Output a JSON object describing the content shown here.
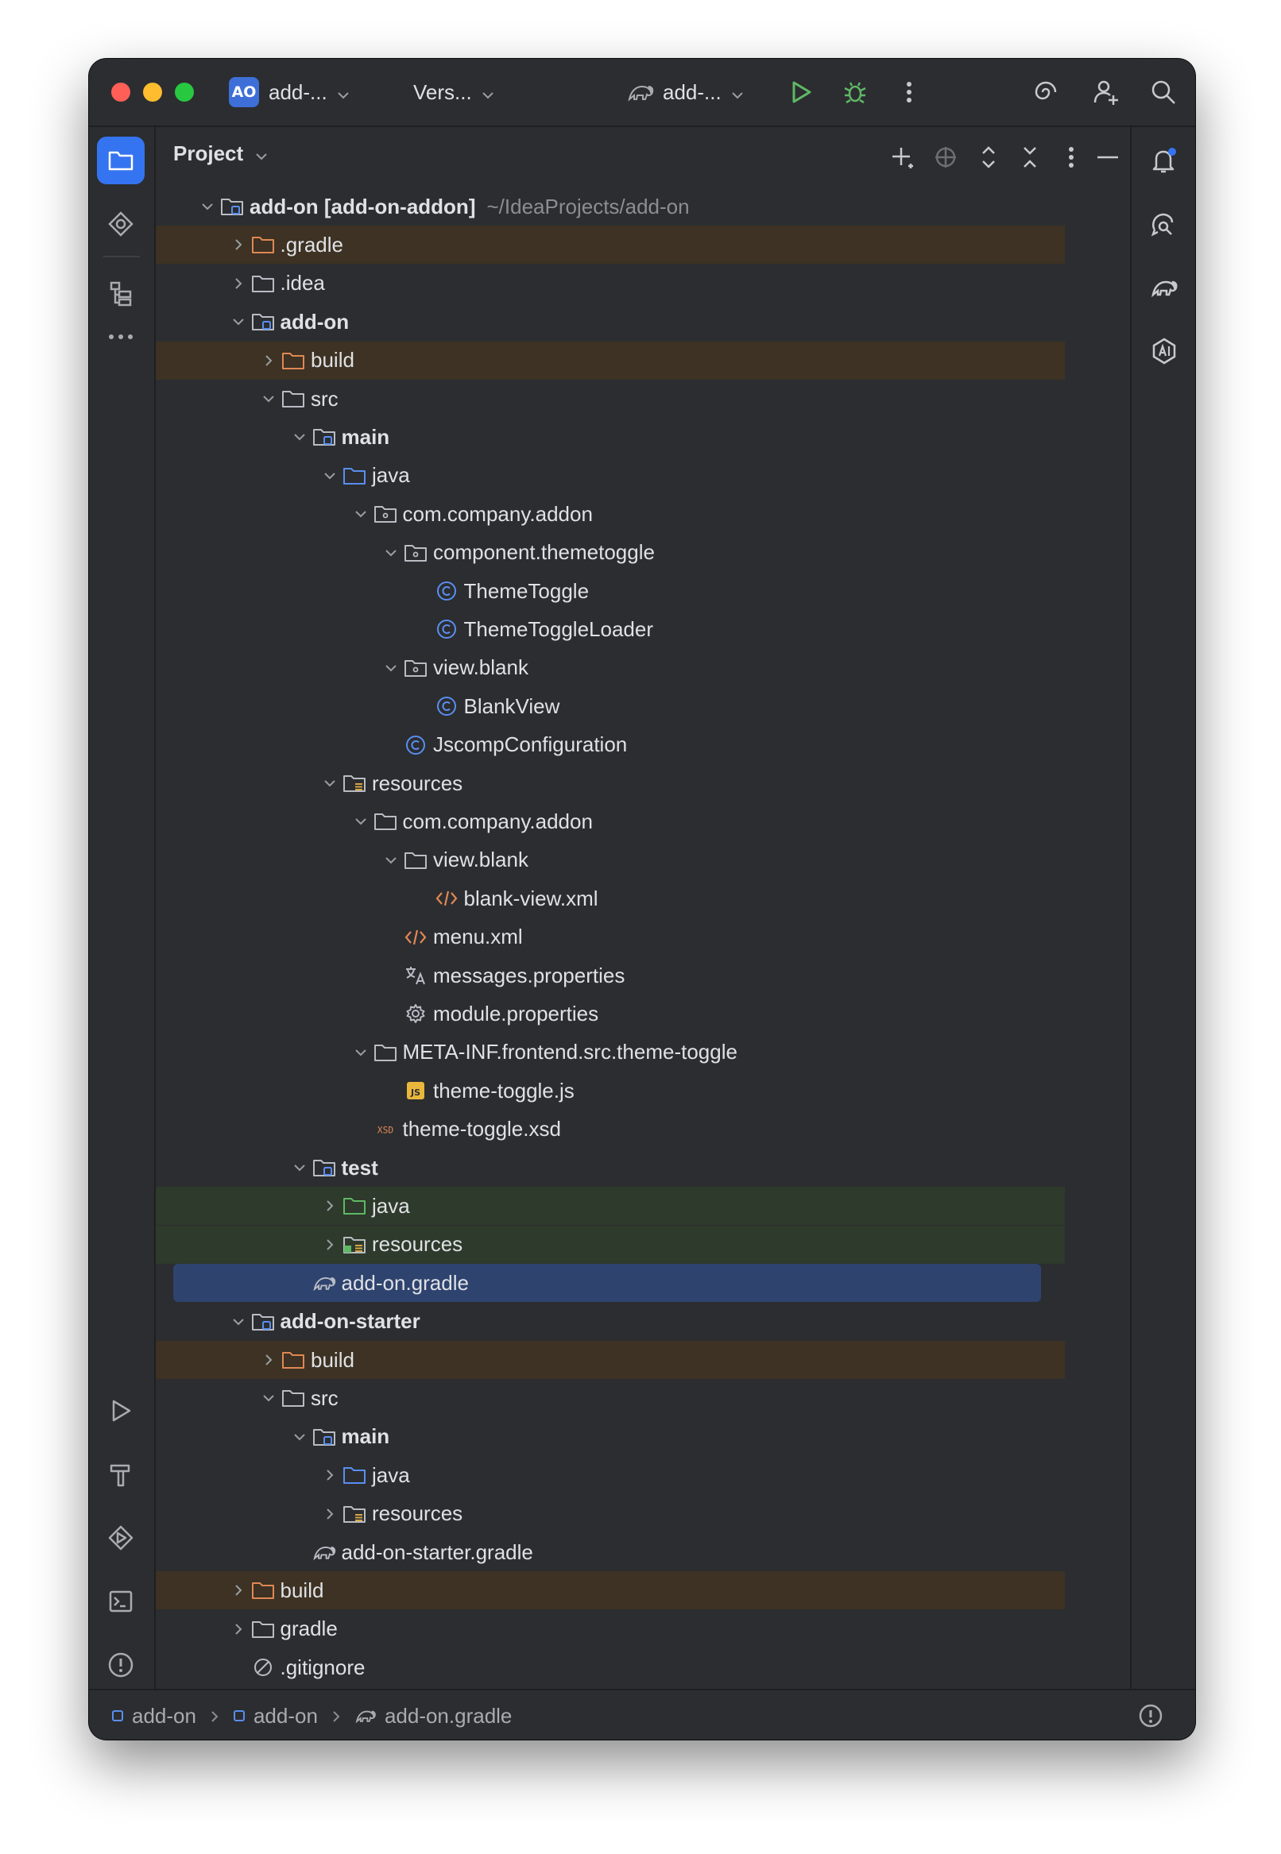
{
  "titlebar": {
    "project_badge": "AO",
    "project_name": "add-...",
    "vcs_label": "Vers...",
    "run_config": "add-..."
  },
  "panel": {
    "title": "Project"
  },
  "tree": [
    {
      "label": "add-on [add-on-addon]",
      "path": "~/IdeaProjects/add-on",
      "bold": true,
      "indent": 0,
      "arrow": "down",
      "icon": "module-folder-icon"
    },
    {
      "label": ".gradle",
      "indent": 1,
      "arrow": "right",
      "icon": "excluded-folder-icon",
      "bg": "build"
    },
    {
      "label": ".idea",
      "indent": 1,
      "arrow": "right",
      "icon": "folder-icon"
    },
    {
      "label": "add-on",
      "bold": true,
      "indent": 1,
      "arrow": "down",
      "icon": "module-folder-icon"
    },
    {
      "label": "build",
      "indent": 2,
      "arrow": "right",
      "icon": "excluded-folder-icon",
      "bg": "build"
    },
    {
      "label": "src",
      "indent": 2,
      "arrow": "down",
      "icon": "folder-icon"
    },
    {
      "label": "main",
      "bold": true,
      "indent": 3,
      "arrow": "down",
      "icon": "module-folder-icon"
    },
    {
      "label": "java",
      "indent": 4,
      "arrow": "down",
      "icon": "source-folder-icon"
    },
    {
      "label": "com.company.addon",
      "indent": 5,
      "arrow": "down",
      "icon": "package-icon"
    },
    {
      "label": "component.themetoggle",
      "indent": 6,
      "arrow": "down",
      "icon": "package-icon"
    },
    {
      "label": "ThemeToggle",
      "indent": 7,
      "arrow": "none",
      "icon": "class-icon"
    },
    {
      "label": "ThemeToggleLoader",
      "indent": 7,
      "arrow": "none",
      "icon": "class-icon"
    },
    {
      "label": "view.blank",
      "indent": 6,
      "arrow": "down",
      "icon": "package-icon"
    },
    {
      "label": "BlankView",
      "indent": 7,
      "arrow": "none",
      "icon": "class-icon"
    },
    {
      "label": "JscompConfiguration",
      "indent": 6,
      "arrow": "none",
      "icon": "class-icon"
    },
    {
      "label": "resources",
      "indent": 4,
      "arrow": "down",
      "icon": "resources-folder-icon"
    },
    {
      "label": "com.company.addon",
      "indent": 5,
      "arrow": "down",
      "icon": "folder-icon"
    },
    {
      "label": "view.blank",
      "indent": 6,
      "arrow": "down",
      "icon": "folder-icon"
    },
    {
      "label": "blank-view.xml",
      "indent": 7,
      "arrow": "none",
      "icon": "xml-icon"
    },
    {
      "label": "menu.xml",
      "indent": 6,
      "arrow": "none",
      "icon": "xml-icon"
    },
    {
      "label": "messages.properties",
      "indent": 6,
      "arrow": "none",
      "icon": "translate-icon"
    },
    {
      "label": "module.properties",
      "indent": 6,
      "arrow": "none",
      "icon": "gear-icon"
    },
    {
      "label": "META-INF.frontend.src.theme-toggle",
      "indent": 5,
      "arrow": "down",
      "icon": "folder-icon"
    },
    {
      "label": "theme-toggle.js",
      "indent": 6,
      "arrow": "none",
      "icon": "js-icon"
    },
    {
      "label": "theme-toggle.xsd",
      "indent": 5,
      "arrow": "none",
      "icon": "xsd-icon"
    },
    {
      "label": "test",
      "bold": true,
      "indent": 3,
      "arrow": "down",
      "icon": "module-folder-icon"
    },
    {
      "label": "java",
      "indent": 4,
      "arrow": "right",
      "icon": "test-folder-icon",
      "bg": "test"
    },
    {
      "label": "resources",
      "indent": 4,
      "arrow": "right",
      "icon": "test-resources-folder-icon",
      "bg": "test"
    },
    {
      "label": "add-on.gradle",
      "indent": 3,
      "arrow": "none",
      "icon": "gradle-icon",
      "selected": true
    },
    {
      "label": "add-on-starter",
      "bold": true,
      "indent": 1,
      "arrow": "down",
      "icon": "module-folder-icon"
    },
    {
      "label": "build",
      "indent": 2,
      "arrow": "right",
      "icon": "excluded-folder-icon",
      "bg": "build"
    },
    {
      "label": "src",
      "indent": 2,
      "arrow": "down",
      "icon": "folder-icon"
    },
    {
      "label": "main",
      "bold": true,
      "indent": 3,
      "arrow": "down",
      "icon": "module-folder-icon"
    },
    {
      "label": "java",
      "indent": 4,
      "arrow": "right",
      "icon": "source-folder-icon"
    },
    {
      "label": "resources",
      "indent": 4,
      "arrow": "right",
      "icon": "resources-folder-icon"
    },
    {
      "label": "add-on-starter.gradle",
      "indent": 3,
      "arrow": "none",
      "icon": "gradle-icon"
    },
    {
      "label": "build",
      "indent": 1,
      "arrow": "right",
      "icon": "excluded-folder-icon",
      "bg": "build"
    },
    {
      "label": "gradle",
      "indent": 1,
      "arrow": "right",
      "icon": "folder-icon"
    },
    {
      "label": ".gitignore",
      "indent": 1,
      "arrow": "none",
      "icon": "ignored-file-icon"
    }
  ],
  "statusbar": {
    "crumbs": [
      "add-on",
      "add-on",
      "add-on.gradle"
    ]
  },
  "colors": {
    "accent": "#3574f0",
    "folder": "#b8bcc4",
    "excluded_folder": "#e08855",
    "source_folder": "#5a8ef0",
    "class_icon": "#5a8ef0",
    "xml_icon": "#e08855",
    "js_icon": "#e8b73b",
    "run_green": "#5fb865",
    "build_bg": "#3d3223",
    "test_bg": "#2e3a2b",
    "selected_bg": "#2e436e"
  }
}
